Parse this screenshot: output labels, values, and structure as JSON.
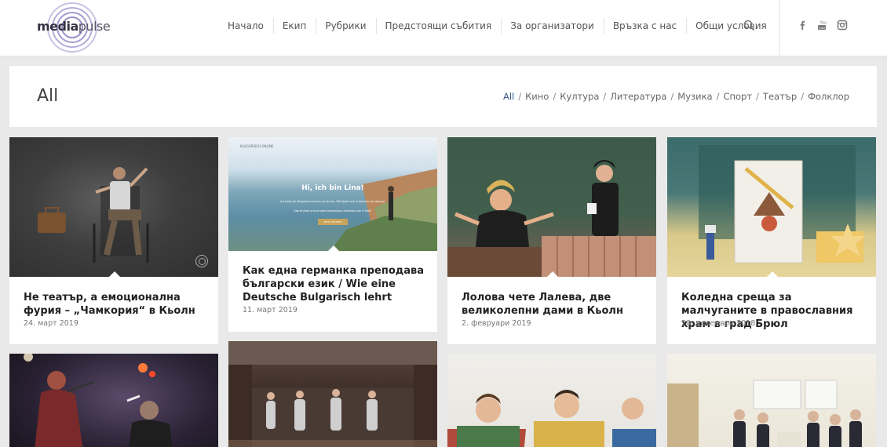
{
  "logo": {
    "text_bold": "media",
    "text_rest": "pulse"
  },
  "nav": {
    "items": [
      "Начало",
      "Екип",
      "Рубрики",
      "Предстоящи събития",
      "За организатори",
      "Връзка с нас",
      "Общи условия"
    ],
    "search_icon": "search-icon"
  },
  "social": [
    "facebook-icon",
    "youtube-icon",
    "instagram-icon"
  ],
  "page": {
    "title": "All",
    "filters": [
      "All",
      "Кино",
      "Култура",
      "Литература",
      "Музика",
      "Спорт",
      "Театър",
      "Фолклор"
    ],
    "active_filter": "All",
    "separator": "/"
  },
  "posts": [
    {
      "title": "Не театър, а емоционална фурия – „Чамкория“ в Кьолн",
      "date": "24. март 2019"
    },
    {
      "title": "Как една германка преподава български език / Wie eine Deutsche Bulgarisch lehrt",
      "date": "11. март 2019",
      "image_text": {
        "top": "BULGARISCH ONLINE",
        "headline": "Hi, ich bin Lina!",
        "body1": "Ich helfe dir Bulgarisch online zu lernen. Mit Spaß und in deinem Lerntempo.",
        "body2": "Starte jetzt und erhalte kostenlose Lektionen per E-Mail!",
        "button": "JETZT STARTEN"
      }
    },
    {
      "title": "Лолова чете Лалева, две великолепни дами в Кьолн",
      "date": "2. февруари 2019"
    },
    {
      "title": "Коледна среща за малчуганите в православния храм в град Брюл",
      "date": "20. декември 2018"
    },
    {
      "title": ""
    },
    {
      "title": ""
    },
    {
      "title": ""
    },
    {
      "title": ""
    }
  ],
  "colors": {
    "accent": "#3a5a8c",
    "background": "#e9e9e9",
    "logo": "#9a8fc7"
  }
}
